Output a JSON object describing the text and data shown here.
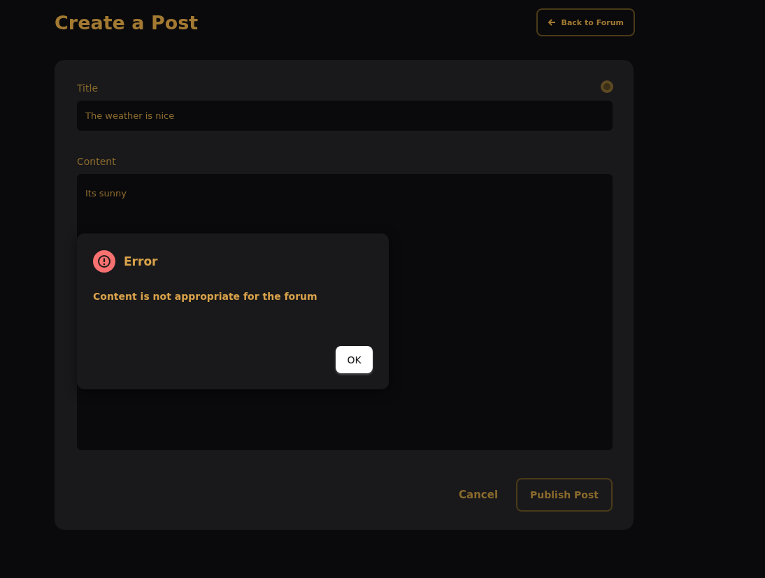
{
  "page": {
    "title": "Create a Post",
    "back_button": "Back to Forum"
  },
  "form": {
    "title_label": "Title",
    "title_value": "The weather is nice",
    "content_label": "Content",
    "content_value": "Its sunny",
    "cancel": "Cancel",
    "publish": "Publish Post"
  },
  "dialog": {
    "kind": "error",
    "title": "Error",
    "message": "Content is not appropriate for the forum",
    "button": "OK"
  }
}
